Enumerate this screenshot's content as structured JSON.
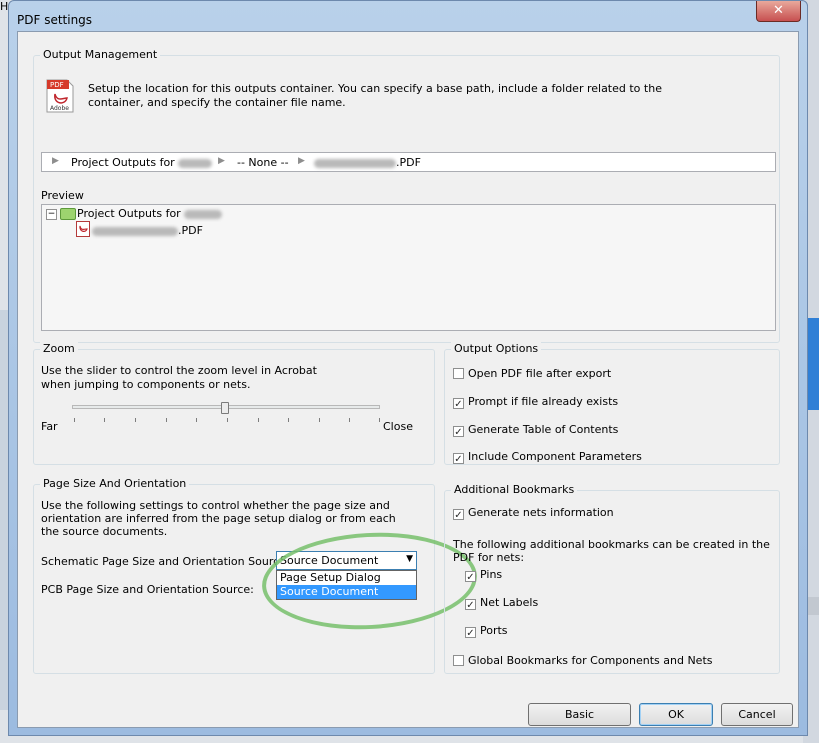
{
  "background": {
    "menu_item": "Help"
  },
  "window": {
    "title": "PDF settings",
    "close_symbol": "✕"
  },
  "output_management": {
    "legend": "Output Management",
    "icon_text_top": "PDF",
    "icon_text_bottom": "Adobe",
    "description": "Setup the location for this outputs container. You can specify a base path, include a folder related to the container, and specify the container file name.",
    "path_segments": [
      "Project Outputs for",
      "-- None --",
      ".PDF"
    ],
    "path_arrow": "▶",
    "preview_label": "Preview",
    "tree_toggle": "−",
    "tree_root": "Project Outputs for",
    "tree_file": ".PDF"
  },
  "zoom": {
    "legend": "Zoom",
    "description": "Use the slider to control the zoom level in Acrobat when jumping to components or nets.",
    "far_label": "Far",
    "close_label": "Close",
    "level": 0.5
  },
  "output_options": {
    "legend": "Output Options",
    "items": [
      {
        "label": "Open PDF file after export",
        "checked": false
      },
      {
        "label": "Prompt if file already exists",
        "checked": true
      },
      {
        "label": "Generate Table of Contents",
        "checked": true
      },
      {
        "label": "Include Component Parameters",
        "checked": true
      }
    ]
  },
  "page_size": {
    "legend": "Page Size And Orientation",
    "description": "Use the following settings to control whether the page size and orientation are inferred from the page setup dialog or from each the source documents.",
    "schematic_label": "Schematic Page Size and Orientation Source:",
    "pcb_label": "PCB Page Size and Orientation Source:",
    "combo_value": "Source Document",
    "combo_arrow": "▼",
    "options": [
      "Page Setup Dialog",
      "Source Document"
    ],
    "selected_option": "Source Document"
  },
  "additional_bookmarks": {
    "legend": "Additional Bookmarks",
    "generate_nets": {
      "label": "Generate nets information",
      "checked": true
    },
    "description": "The following additional bookmarks can be created in the PDF for nets:",
    "sub_items": [
      {
        "label": "Pins",
        "checked": true
      },
      {
        "label": "Net Labels",
        "checked": true
      },
      {
        "label": "Ports",
        "checked": true
      }
    ],
    "global": {
      "label": "Global Bookmarks for Components and Nets",
      "checked": false
    }
  },
  "buttons": {
    "basic": "Basic",
    "ok": "OK",
    "cancel": "Cancel"
  },
  "check_mark": "✓",
  "colors": {
    "title_bar": "#b9d1ea",
    "close_button": "#c75050",
    "selection": "#3399ff",
    "annotation_circle": "#77c06b"
  }
}
